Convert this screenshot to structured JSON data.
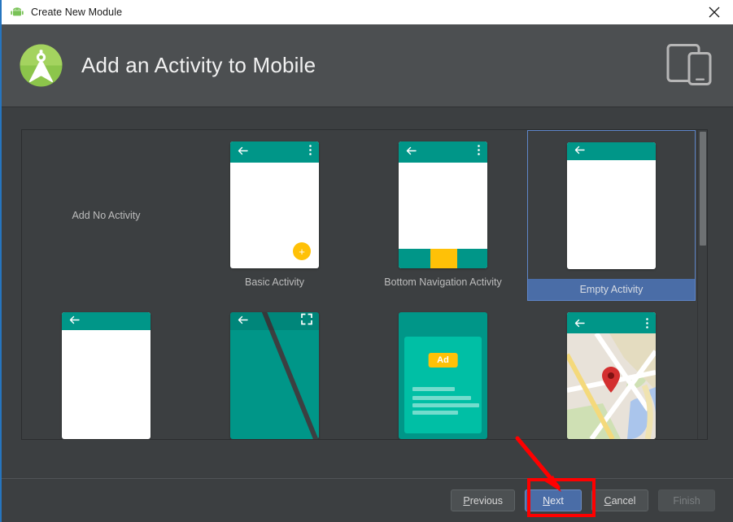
{
  "window": {
    "title": "Create New Module",
    "title_icon": "android-icon",
    "close_icon": "close-icon"
  },
  "header": {
    "title": "Add an Activity to Mobile",
    "logo_icon": "android-studio-logo",
    "device_icon": "tablet-and-phone-icon"
  },
  "gallery": {
    "templates": [
      {
        "label": "Add No Activity",
        "kind": "none",
        "selected": false
      },
      {
        "label": "Basic Activity",
        "kind": "basic",
        "selected": false
      },
      {
        "label": "Bottom Navigation Activity",
        "kind": "bottom-nav",
        "selected": false
      },
      {
        "label": "Empty Activity",
        "kind": "empty",
        "selected": true
      },
      {
        "label": "",
        "kind": "plain",
        "selected": false
      },
      {
        "label": "",
        "kind": "fullscreen",
        "selected": false
      },
      {
        "label": "",
        "kind": "ad",
        "selected": false
      },
      {
        "label": "",
        "kind": "map",
        "selected": false
      }
    ],
    "ad_badge": "Ad",
    "scrollbar": {
      "name": "vertical-scrollbar",
      "position": "top"
    }
  },
  "footer": {
    "previous": {
      "mnemonic": "P",
      "rest": "revious"
    },
    "next": {
      "mnemonic": "N",
      "rest": "ext"
    },
    "cancel": {
      "mnemonic": "C",
      "rest": "ancel"
    },
    "finish": {
      "mnemonic": "F",
      "rest": "inish",
      "disabled": true
    }
  },
  "annotations": {
    "highlight_target": "next-button",
    "arrow_color": "#ff0000",
    "box_color": "#ff0000"
  },
  "colors": {
    "dialog_bg": "#3c3f41",
    "header_bg": "#4c4f51",
    "selection_blue": "#4a6da7",
    "teal": "#009688",
    "amber": "#ffc107",
    "android_green": "#8bc34a"
  }
}
